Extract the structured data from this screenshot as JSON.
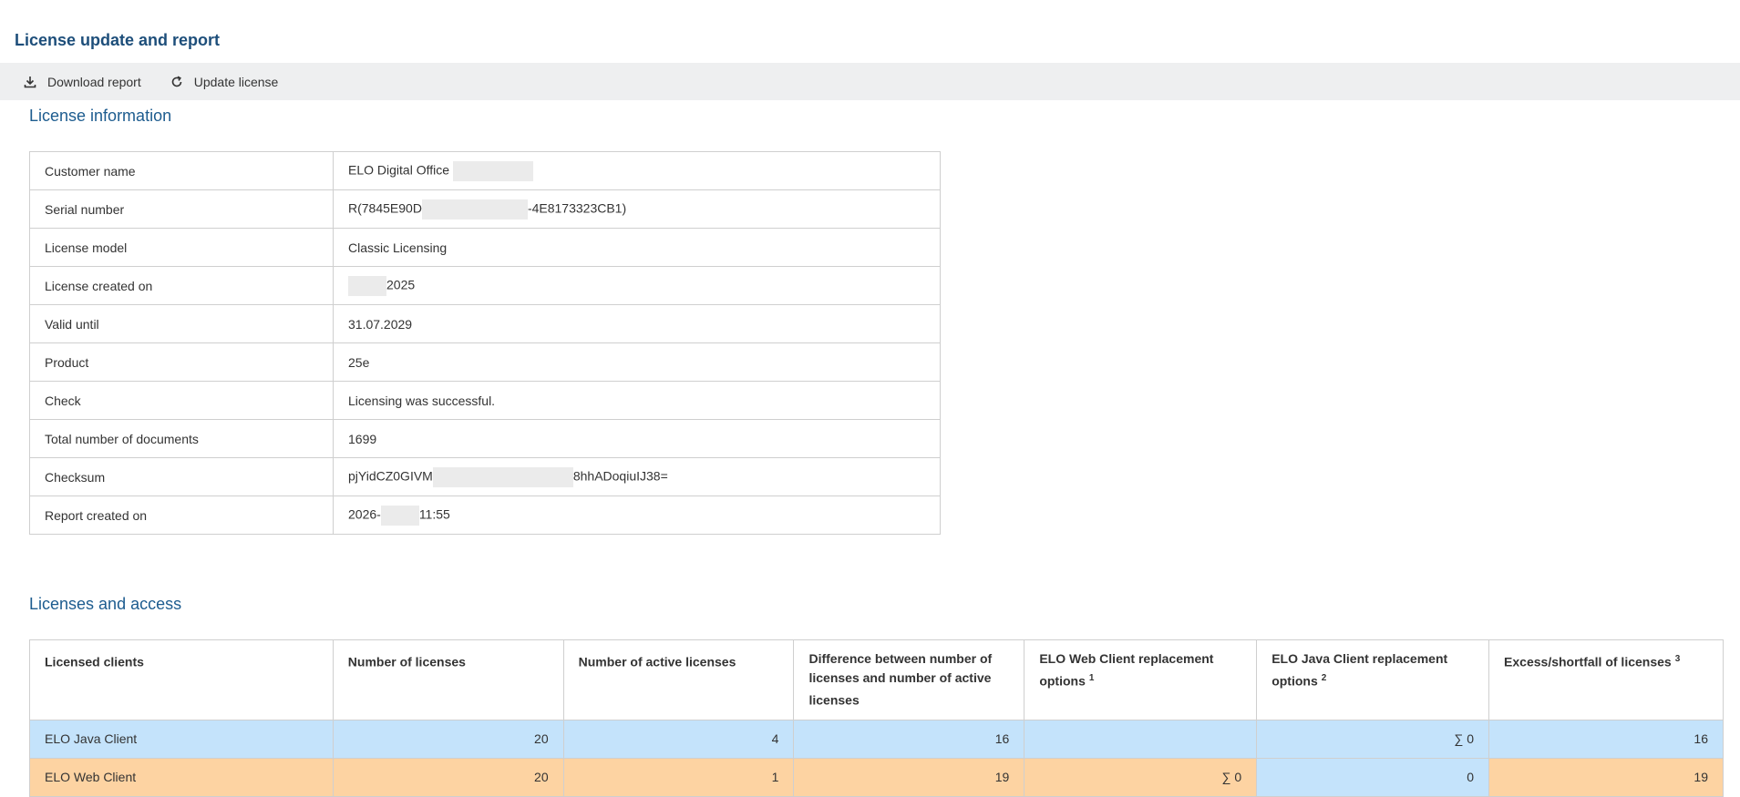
{
  "page": {
    "title": "License update and report"
  },
  "toolbar": {
    "download_label": "Download report",
    "update_label": "Update license"
  },
  "license_info": {
    "title": "License information",
    "rows": [
      {
        "label": "Customer name",
        "value_prefix": "ELO Digital Office",
        "value_suffix": ""
      },
      {
        "label": "Serial number",
        "value_prefix": "R(7845E90D",
        "value_suffix": "-4E8173323CB1)"
      },
      {
        "label": "License model",
        "value_prefix": "Classic Licensing",
        "value_suffix": ""
      },
      {
        "label": "License created on",
        "value_prefix": "",
        "value_suffix": "2025"
      },
      {
        "label": "Valid until",
        "value_prefix": "31.07.2029",
        "value_suffix": ""
      },
      {
        "label": "Product",
        "value_prefix": "25e",
        "value_suffix": ""
      },
      {
        "label": "Check",
        "value_prefix": "Licensing was successful.",
        "value_suffix": ""
      },
      {
        "label": "Total number of documents",
        "value_prefix": "1699",
        "value_suffix": ""
      },
      {
        "label": "Checksum",
        "value_prefix": "pjYidCZ0GIVM",
        "value_suffix": "8hhADoqiuIJ38="
      },
      {
        "label": "Report created on",
        "value_prefix": "2026-",
        "value_suffix": "11:55"
      }
    ]
  },
  "access": {
    "title": "Licenses and access",
    "headers": [
      {
        "text": "Licensed clients",
        "sup": ""
      },
      {
        "text": "Number of licenses",
        "sup": ""
      },
      {
        "text": "Number of active licenses",
        "sup": ""
      },
      {
        "text": "Difference between number of licenses and number of active licenses",
        "sup": ""
      },
      {
        "text": "ELO Web Client replacement options",
        "sup": "1"
      },
      {
        "text": "ELO Java Client replacement options",
        "sup": "2"
      },
      {
        "text": "Excess/shortfall of licenses",
        "sup": "3"
      }
    ],
    "rows": [
      {
        "client": "ELO Java Client",
        "licenses": "20",
        "active": "4",
        "difference": "16",
        "web_replacement": "",
        "java_replacement": "∑ 0",
        "excess": "16"
      },
      {
        "client": "ELO Web Client",
        "licenses": "20",
        "active": "1",
        "difference": "19",
        "web_replacement": "∑ 0",
        "java_replacement": "0",
        "excess": "19"
      }
    ]
  },
  "colors": {
    "title": "#1d4e7a",
    "section_title": "#1d5c8f",
    "toolbar_bg": "#eeeff0",
    "row_blue": "#c4e3fb",
    "row_orange": "#fdd3a2"
  }
}
